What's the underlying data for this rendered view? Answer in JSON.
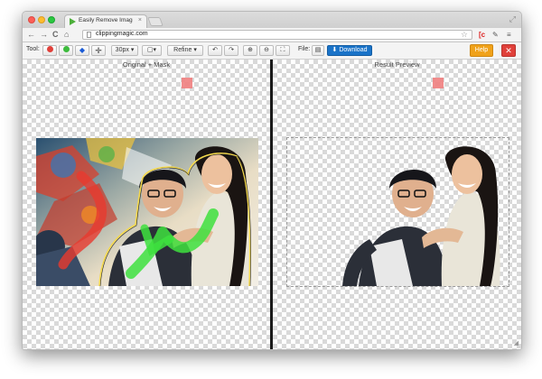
{
  "browser": {
    "tab_title": "Easily Remove Image Backg",
    "tab_close": "×",
    "url": "clippingmagic.com",
    "nav": {
      "back": "←",
      "forward": "→",
      "reload": "C",
      "home": "⌂"
    }
  },
  "toolbar": {
    "tool_label": "Tool:",
    "brush_size": "30px",
    "refine_label": "Refine",
    "file_label": "File:",
    "download_label": "Download",
    "help_label": "Help",
    "close_label": "✕",
    "tool_colors": {
      "remove": "#e0403a",
      "keep": "#3dbb3d",
      "hair": "#1a5bd6"
    }
  },
  "panes": {
    "left_title": "Original + Mask",
    "right_title": "Result Preview"
  },
  "colors": {
    "accent_blue": "#1a73c8",
    "help_orange": "#f0a21a",
    "close_red": "#e0403a",
    "mask_green": "#3ee03e",
    "mask_red": "#e8392e"
  }
}
